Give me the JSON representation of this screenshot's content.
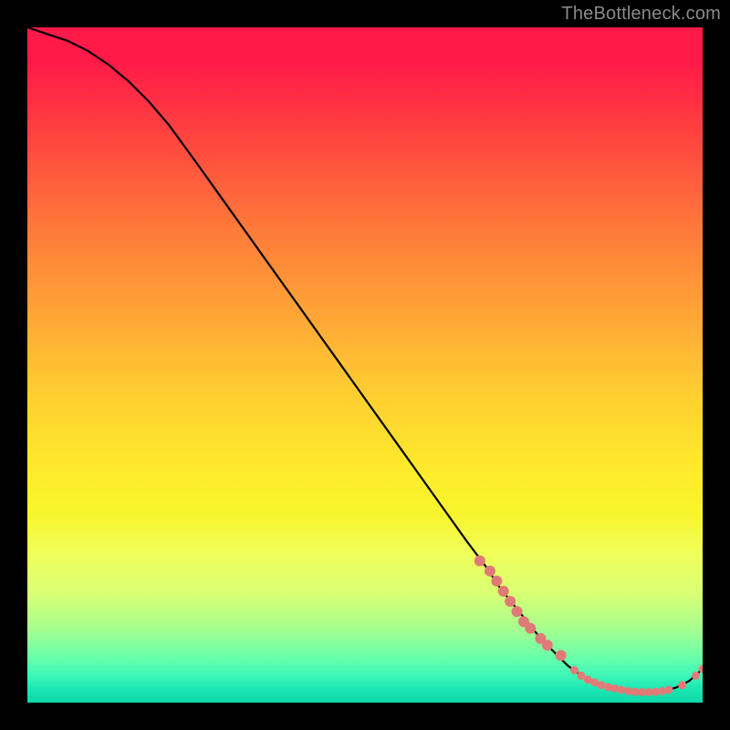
{
  "attribution": "TheBottleneck.com",
  "colors": {
    "background": "#000000",
    "text": "#8a8a8a",
    "marker": "#e27b78",
    "curve": "#000000",
    "gradient_stops": [
      "#ff1a48",
      "#ff4040",
      "#ff7a3a",
      "#ffae36",
      "#ffd030",
      "#ffe92c",
      "#f7f52c",
      "#f0ff5a",
      "#d8ff74",
      "#a6ff8e",
      "#6effa8",
      "#3cf7b8",
      "#1de5b4",
      "#0ed9a8"
    ]
  },
  "chart_data": {
    "type": "line",
    "title": "",
    "xlabel": "",
    "ylabel": "",
    "xlim": [
      0,
      100
    ],
    "ylim": [
      0,
      100
    ],
    "grid": false,
    "legend": false,
    "x": [
      0,
      3,
      6,
      9,
      12,
      15,
      18,
      21,
      25,
      30,
      35,
      40,
      45,
      50,
      55,
      60,
      65,
      68,
      70,
      72,
      74,
      76,
      78,
      80,
      82,
      84,
      86,
      88,
      90,
      92,
      94,
      96,
      98,
      100
    ],
    "values": [
      100,
      99,
      98,
      96.5,
      94.5,
      92,
      89,
      85.5,
      80,
      73,
      66,
      59,
      52,
      45,
      38,
      31,
      24,
      20,
      17,
      14.5,
      12,
      9.5,
      7.5,
      5.5,
      4,
      3,
      2.3,
      1.8,
      1.5,
      1.5,
      1.7,
      2.2,
      3.2,
      5
    ],
    "markers_cluster_a_x": [
      67,
      68.5,
      69.5,
      70.5,
      71.5,
      72.5,
      73.5,
      74.5,
      76,
      77,
      79
    ],
    "markers_cluster_a_y": [
      21,
      19.5,
      18,
      16.5,
      15,
      13.5,
      12,
      11,
      9.5,
      8.5,
      7.0
    ],
    "markers_cluster_b_x": [
      81,
      82,
      83,
      84,
      85,
      86,
      87,
      88,
      89,
      90,
      91,
      92,
      93,
      94,
      95
    ],
    "markers_cluster_b_y": [
      4.8,
      4.0,
      3.4,
      3.0,
      2.6,
      2.3,
      2.1,
      1.9,
      1.7,
      1.6,
      1.55,
      1.55,
      1.6,
      1.7,
      1.9
    ],
    "markers_trail_x": [
      97,
      99,
      100
    ],
    "markers_trail_y": [
      2.6,
      4.0,
      5.0
    ],
    "marker_radius_small": 4.5,
    "marker_radius_large": 6.0
  }
}
